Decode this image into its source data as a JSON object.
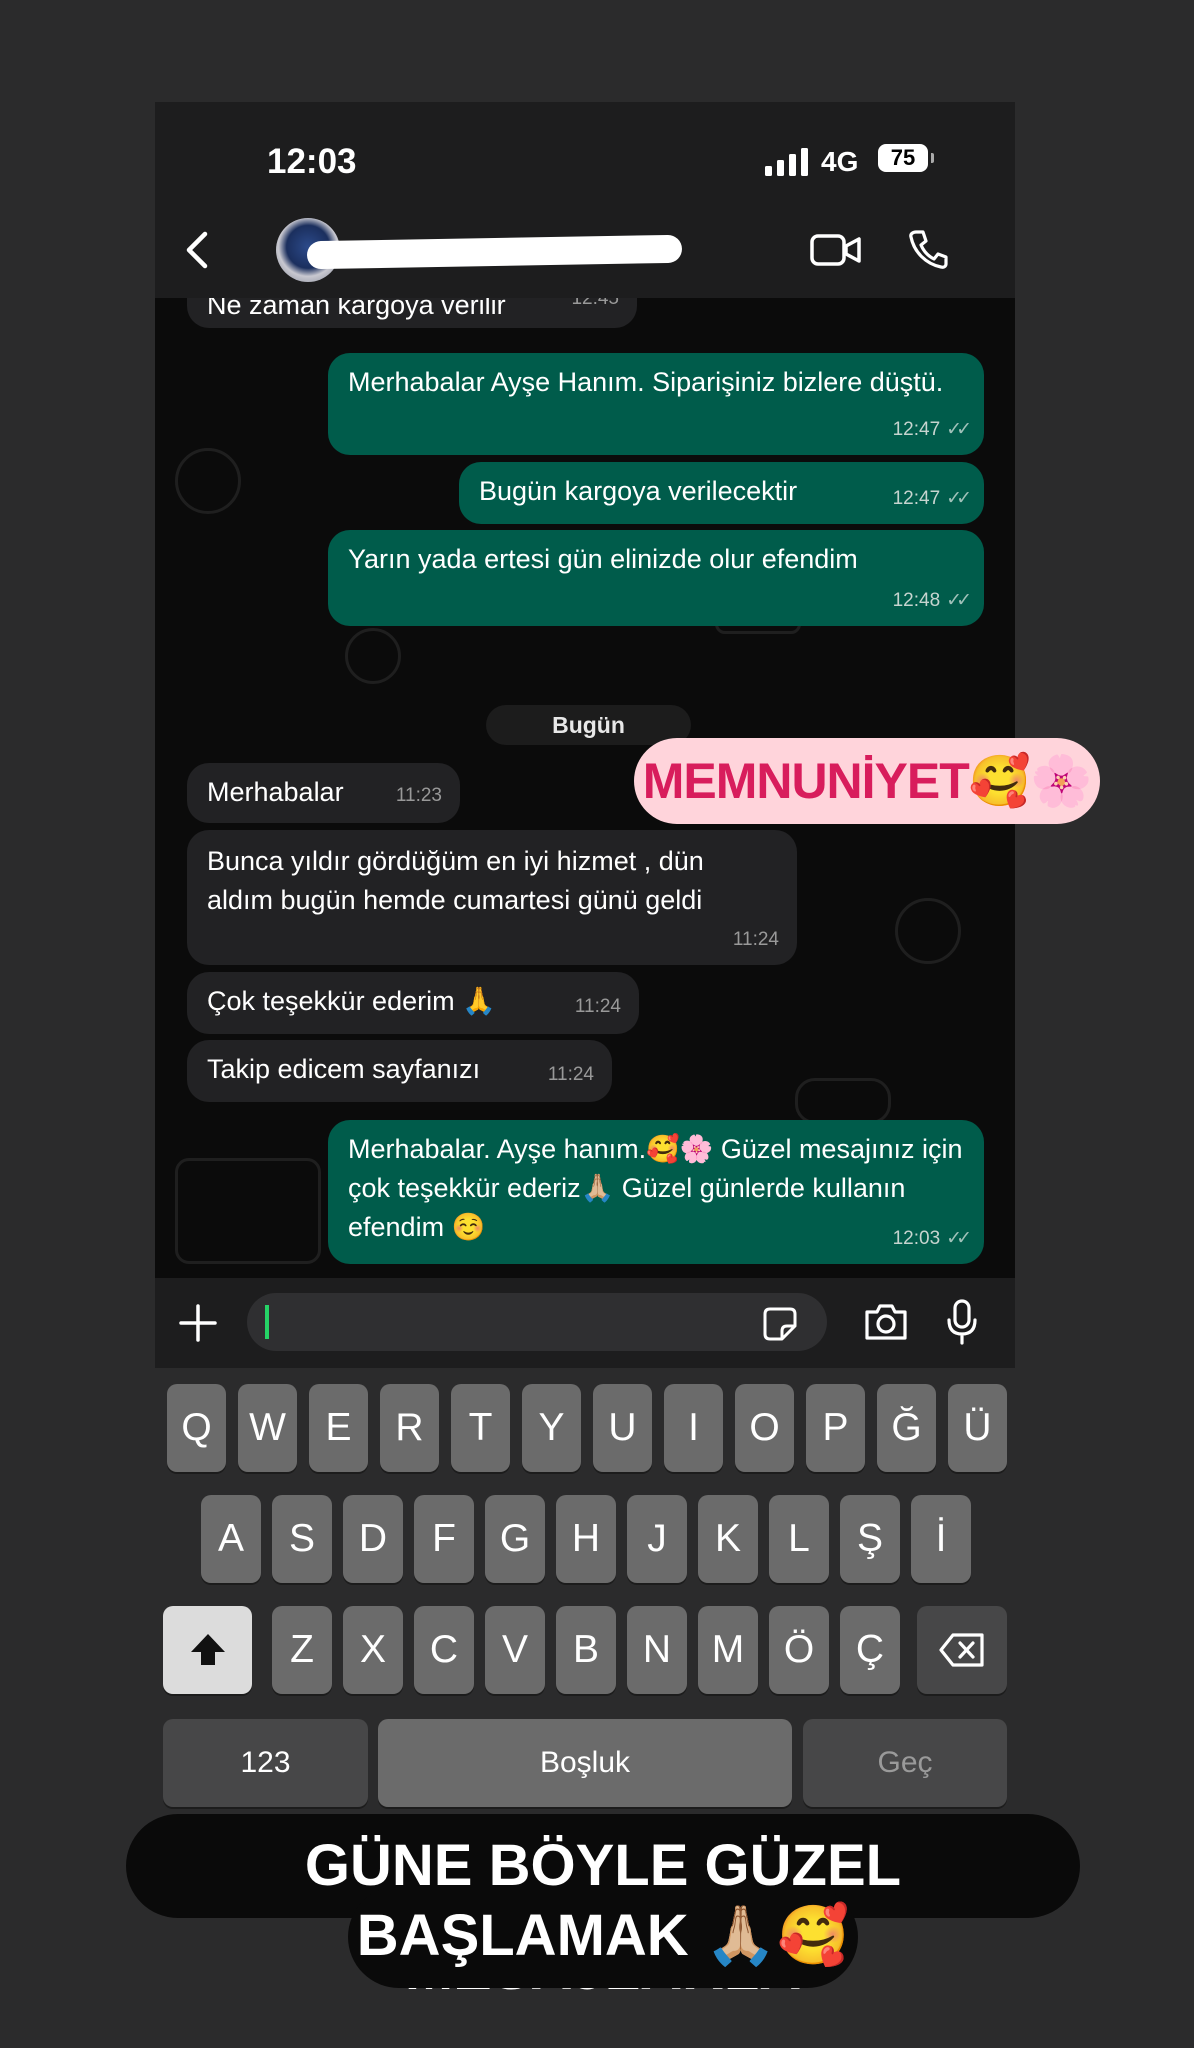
{
  "status_bar": {
    "time": "12:03",
    "network": "4G",
    "battery": "75"
  },
  "chat_header": {
    "contact_name_redacted": "",
    "video_icon": "video-camera-icon",
    "call_icon": "phone-icon"
  },
  "messages": [
    {
      "dir": "in",
      "text": "Ne zaman kargoya verilir",
      "time": "12:45"
    },
    {
      "dir": "out",
      "text": "Merhabalar Ayşe Hanım. Siparişiniz bizlere düştü.",
      "time": "12:47"
    },
    {
      "dir": "out",
      "text": "Bugün kargoya verilecektir",
      "time": "12:47"
    },
    {
      "dir": "out",
      "text": "Yarın yada ertesi gün elinizde olur efendim",
      "time": "12:48"
    },
    {
      "dir": "in",
      "text": "Merhabalar",
      "time": "11:23"
    },
    {
      "dir": "in",
      "text": "Bunca yıldır gördüğüm en iyi hizmet , dün aldım bugün hemde cumartesi günü geldi",
      "time": "11:24"
    },
    {
      "dir": "in",
      "text": "Çok teşekkür ederim 🙏",
      "time": "11:24"
    },
    {
      "dir": "in",
      "text": "Takip edicem sayfanızı",
      "time": "11:24"
    },
    {
      "dir": "out",
      "text": "Merhabalar. Ayşe hanım.🥰🌸 Güzel mesajınız için çok teşekkür ederiz🙏🏼 Güzel günlerde kullanın efendim ☺️",
      "time": "12:03"
    }
  ],
  "date_divider": "Bugün",
  "ticks": "✓✓",
  "sticker": "MEMNUNİYET🥰🌸",
  "keyboard": {
    "row1": [
      "Q",
      "W",
      "E",
      "R",
      "T",
      "Y",
      "U",
      "I",
      "O",
      "P",
      "Ğ",
      "Ü"
    ],
    "row2": [
      "A",
      "S",
      "D",
      "F",
      "G",
      "H",
      "J",
      "K",
      "L",
      "Ş",
      "İ"
    ],
    "row3": [
      "Z",
      "X",
      "C",
      "V",
      "B",
      "N",
      "M",
      "Ö",
      "Ç"
    ],
    "numbers": "123",
    "space": "Boşluk",
    "return": "Geç"
  },
  "caption": {
    "line1": "GÜNE BÖYLE GÜZEL MESAJLARLA",
    "line2": "BAŞLAMAK 🙏🏼🥰"
  },
  "colors": {
    "outgoing": "#005c4b",
    "incoming": "#222224",
    "accent": "#25d366",
    "sticker_text": "#d81d5c",
    "sticker_bg": "#ffd4db"
  }
}
